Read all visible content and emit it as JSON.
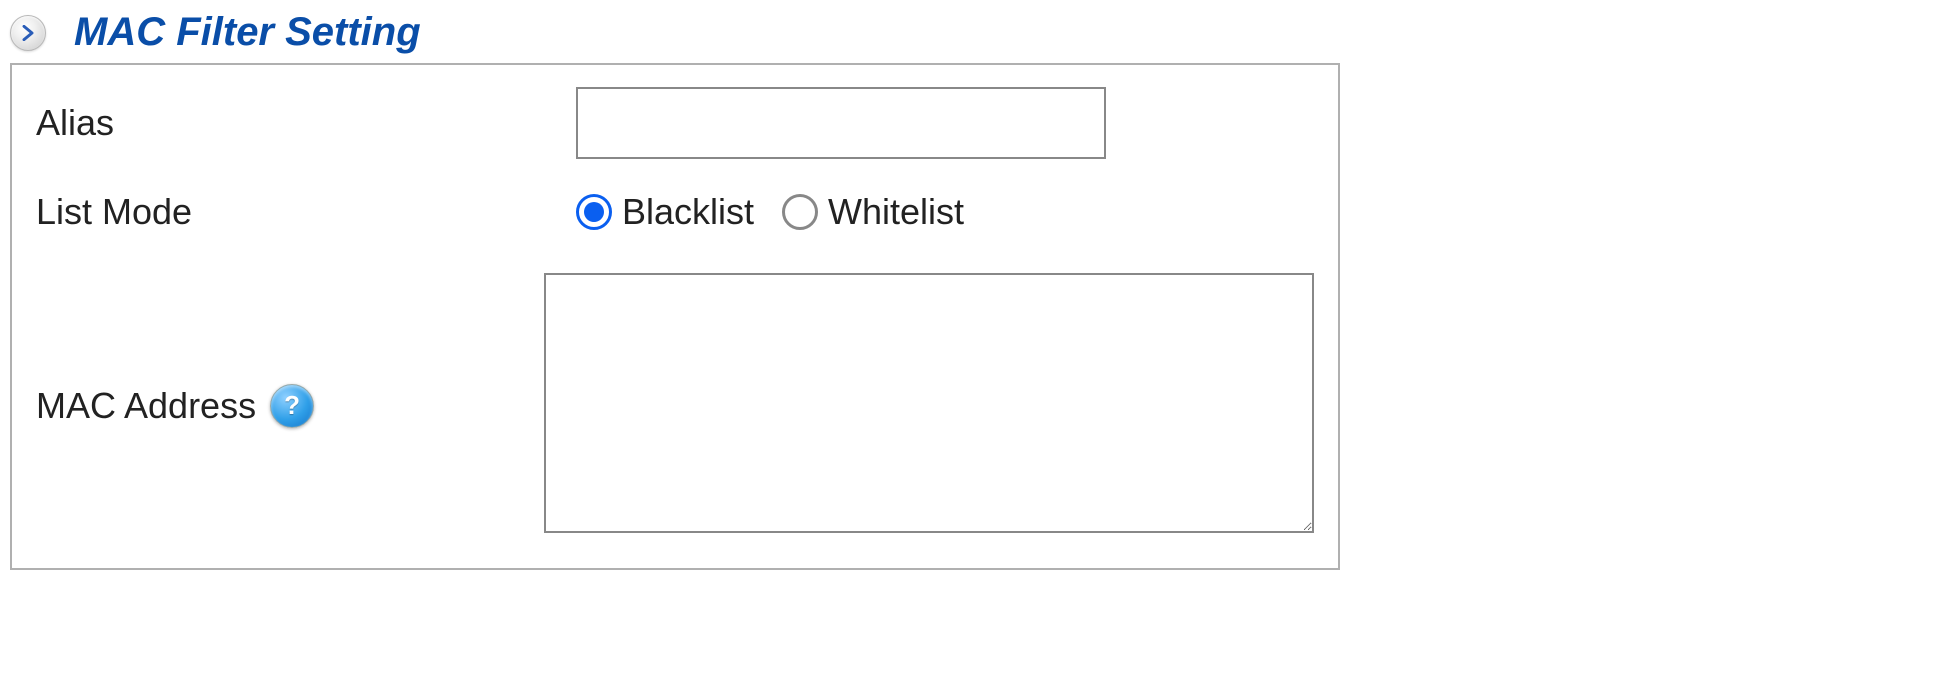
{
  "section": {
    "title": "MAC Filter Setting"
  },
  "form": {
    "alias": {
      "label": "Alias",
      "value": ""
    },
    "listMode": {
      "label": "List Mode",
      "options": {
        "blacklist": "Blacklist",
        "whitelist": "Whitelist"
      },
      "selected": "blacklist"
    },
    "macAddress": {
      "label": "MAC Address",
      "value": "",
      "helpSymbol": "?"
    }
  }
}
